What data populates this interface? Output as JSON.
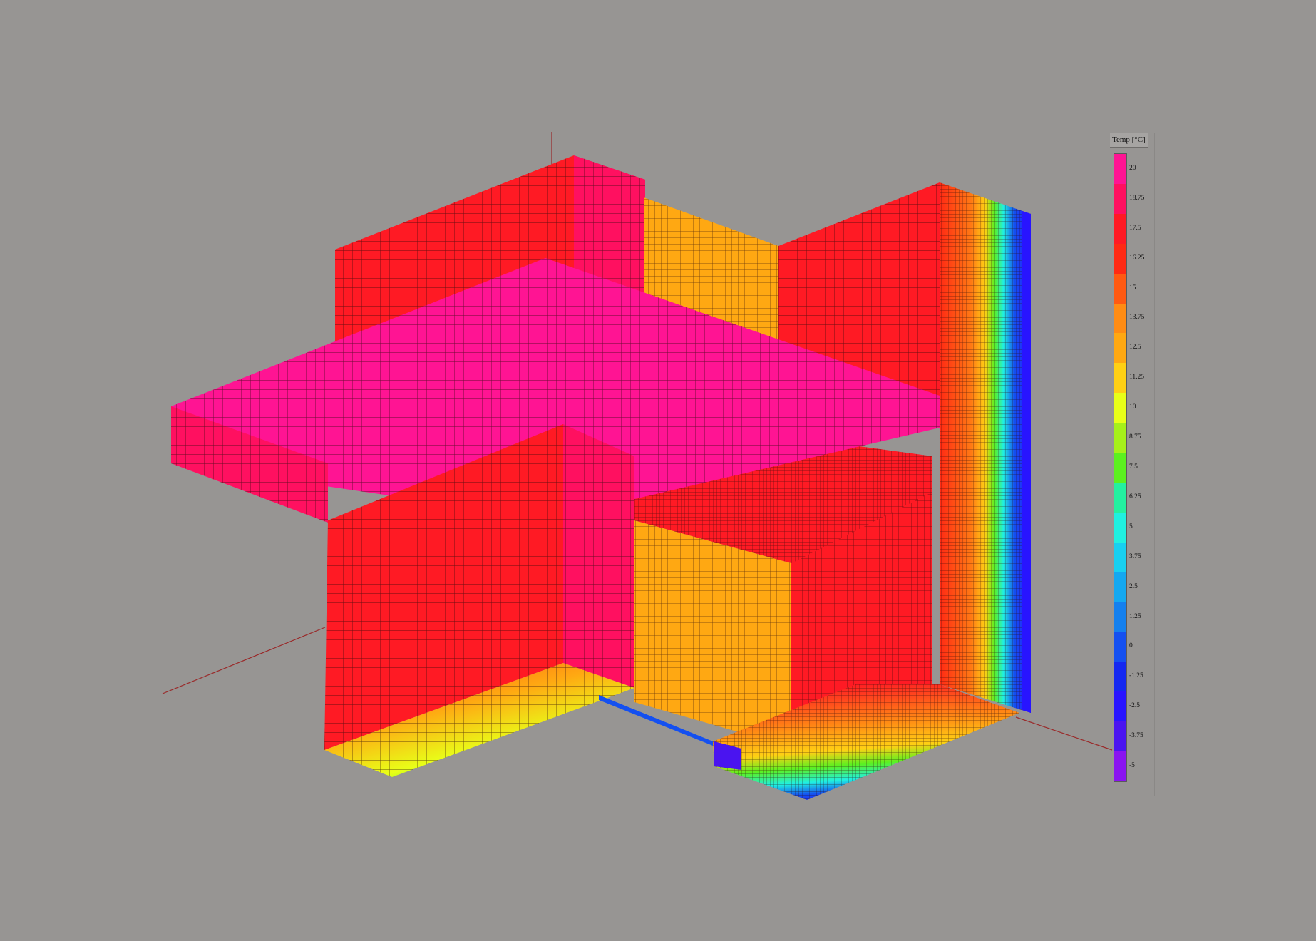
{
  "legend": {
    "title": "Temp [°C]",
    "labels": [
      "20",
      "18.75",
      "17.5",
      "16.25",
      "15",
      "13.75",
      "12.5",
      "11.25",
      "10",
      "8.75",
      "7.5",
      "6.25",
      "5",
      "3.75",
      "2.5",
      "1.25",
      "0",
      "-1.25",
      "-2.5",
      "-3.75",
      "-5"
    ],
    "colors": [
      "#ff1493",
      "#ff1060",
      "#ff1a24",
      "#ff2a14",
      "#ff5a12",
      "#ff8c14",
      "#ffa812",
      "#ffd014",
      "#e8ff18",
      "#a6f01a",
      "#5cf020",
      "#24f0a0",
      "#20f0e0",
      "#18d0f0",
      "#14a8f0",
      "#1480ee",
      "#1450f0",
      "#1428f0",
      "#2814ff",
      "#4a14f0",
      "#8a14f0"
    ]
  },
  "colors": {
    "background": "#979593",
    "mesh_line": "#2a0808",
    "axis_line": "#9a2a2a"
  }
}
